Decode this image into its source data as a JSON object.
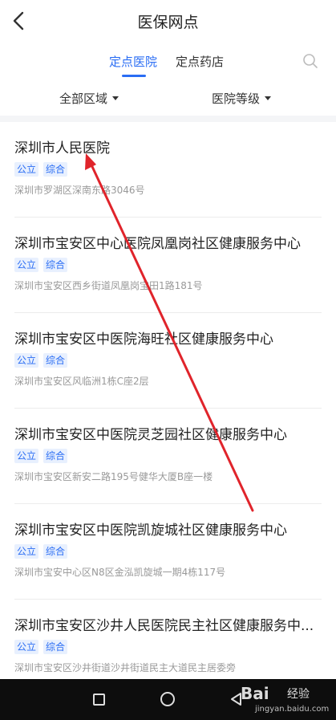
{
  "header": {
    "title": "医保网点"
  },
  "tabs": [
    {
      "label": "定点医院",
      "active": true
    },
    {
      "label": "定点药店",
      "active": false
    }
  ],
  "filters": {
    "area": "全部区域",
    "level": "医院等级"
  },
  "items": [
    {
      "name": "深圳市人民医院",
      "tags": [
        "公立",
        "综合"
      ],
      "address": "深圳市罗湖区深南东路3046号"
    },
    {
      "name": "深圳市宝安区中心医院凤凰岗社区健康服务中心",
      "tags": [
        "公立",
        "综合"
      ],
      "address": "深圳市宝安区西乡街道凤凰岗宝田1路181号"
    },
    {
      "name": "深圳市宝安区中医院海旺社区健康服务中心",
      "tags": [
        "公立",
        "综合"
      ],
      "address": "深圳市宝安区风临洲1栋C座2层"
    },
    {
      "name": "深圳市宝安区中医院灵芝园社区健康服务中心",
      "tags": [
        "公立",
        "综合"
      ],
      "address": "深圳市宝安区新安二路195号健华大厦B座一楼"
    },
    {
      "name": "深圳市宝安区中医院凯旋城社区健康服务中心",
      "tags": [
        "公立",
        "综合"
      ],
      "address": "深圳市宝安中心区N8区金泓凯旋城一期4栋117号"
    },
    {
      "name": "深圳市宝安区沙井人民医院民主社区健康服务中...",
      "tags": [
        "公立",
        "综合"
      ],
      "address": "深圳市宝安区沙井街道沙井街道民主大道民主居委旁"
    }
  ],
  "watermark": {
    "logo": "Bai",
    "text": "经验",
    "url": "jingyan.baidu.com"
  },
  "colors": {
    "accent": "#2a6df4",
    "annotation_arrow": "#e0242b"
  }
}
